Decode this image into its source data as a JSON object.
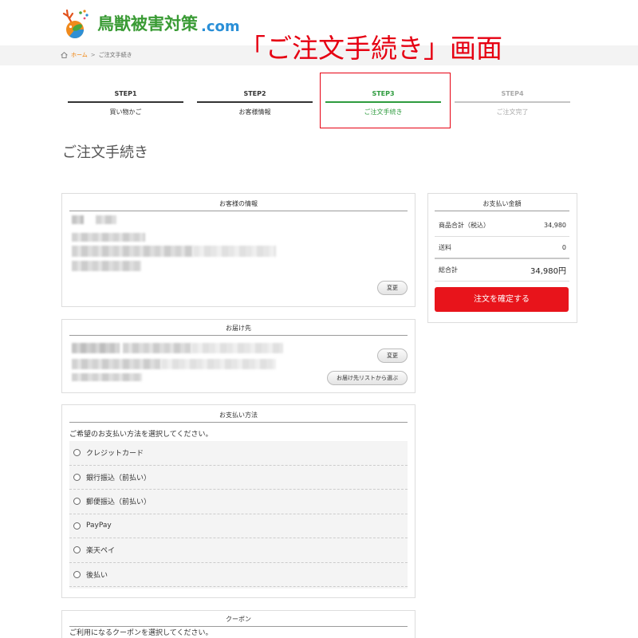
{
  "site": {
    "logo_icon": "deer-logo-icon",
    "name": "鳥獣被害対策",
    "domain_suffix": ".com"
  },
  "annotation": "「ご注文手続き」画面",
  "breadcrumb": {
    "home_icon": "home-icon",
    "home": "ホーム",
    "separator": ">",
    "current": "ご注文手続き"
  },
  "steps": [
    {
      "step": "STEP1",
      "label": "買い物かご",
      "done": true,
      "current": false
    },
    {
      "step": "STEP2",
      "label": "お客様情報",
      "done": true,
      "current": false
    },
    {
      "step": "STEP3",
      "label": "ご注文手続き",
      "done": false,
      "current": true
    },
    {
      "step": "STEP4",
      "label": "ご注文完了",
      "done": false,
      "current": false
    }
  ],
  "page_title": "ご注文手続き",
  "customer_info": {
    "title": "お客様の情報",
    "change_button": "変更"
  },
  "delivery": {
    "title": "お届け先",
    "change_button": "変更",
    "choose_from_list_button": "お届け先リストから選ぶ"
  },
  "payment_method": {
    "title": "お支払い方法",
    "prompt": "ご希望のお支払い方法を選択してください。",
    "options": [
      {
        "label": "クレジットカード",
        "selected": false
      },
      {
        "label": "銀行振込（前払い）",
        "selected": false
      },
      {
        "label": "郵便振込（前払い）",
        "selected": false
      },
      {
        "label": "PayPay",
        "selected": false
      },
      {
        "label": "楽天ペイ",
        "selected": false
      },
      {
        "label": "後払い",
        "selected": false
      }
    ]
  },
  "coupon": {
    "title": "クーポン",
    "prompt": "ご利用になるクーポンを選択してください。"
  },
  "payment_summary": {
    "title": "お支払い金額",
    "rows": [
      {
        "label": "商品合計（税込）",
        "value": "34,980"
      },
      {
        "label": "送料",
        "value": "0"
      }
    ],
    "total": {
      "label": "総合計",
      "value": "34,980円"
    },
    "confirm_button": "注文を確定する"
  },
  "colors": {
    "brand_green": "#3a9b35",
    "brand_blue": "#2a8fd7",
    "annotation_red": "#e60012",
    "breadcrumb_link": "#ef7d00",
    "step_current": "#2e9b3e",
    "step_done": "#333333",
    "step_pending": "#aaaaaa",
    "confirm_button": "#e8141b"
  }
}
